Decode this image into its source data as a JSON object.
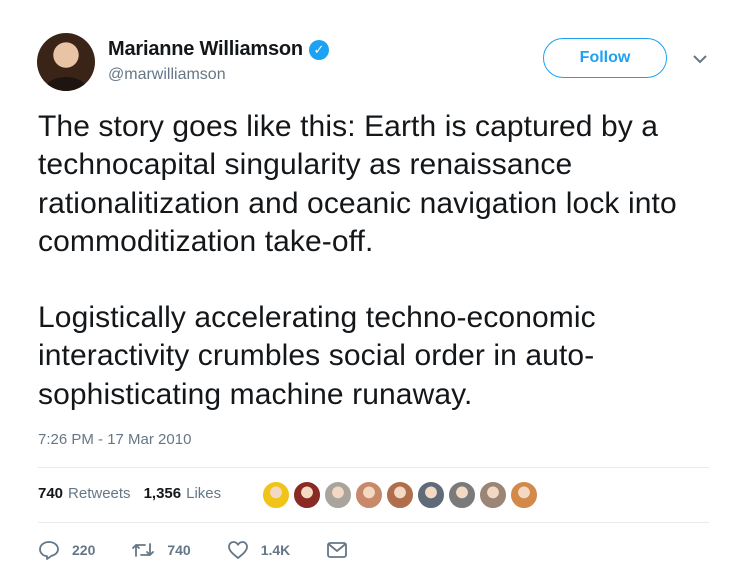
{
  "author": {
    "name": "Marianne Williamson",
    "handle": "@marwilliamson",
    "verified": true
  },
  "follow_button": {
    "label": "Follow"
  },
  "tweet": {
    "paragraphs": [
      "The story goes like this: Earth is captured by a technocapital singularity as renaissance rationalitization and oceanic navigation lock into commoditization take-off.",
      "Logistically accelerating techno-economic interactivity crumbles social order in auto-sophisticating machine runaway."
    ],
    "timestamp": "7:26 PM - 17 Mar 2010"
  },
  "stats": {
    "retweets": {
      "count": "740",
      "label": "Retweets"
    },
    "likes": {
      "count": "1,356",
      "label": "Likes"
    }
  },
  "liker_faces": [
    "#f0c419",
    "#8a2a24",
    "#a9a49c",
    "#c8886a",
    "#b06e4c",
    "#5f6b78",
    "#7a7a7a",
    "#9a8576",
    "#d2894a"
  ],
  "actions": {
    "reply": {
      "icon": "reply-icon",
      "count": "220"
    },
    "retweet": {
      "icon": "retweet-icon",
      "count": "740"
    },
    "like": {
      "icon": "heart-icon",
      "count": "1.4K"
    },
    "message": {
      "icon": "envelope-icon"
    }
  },
  "colors": {
    "accent": "#1da1f2",
    "secondary_text": "#657786",
    "divider": "#e6ecf0"
  }
}
